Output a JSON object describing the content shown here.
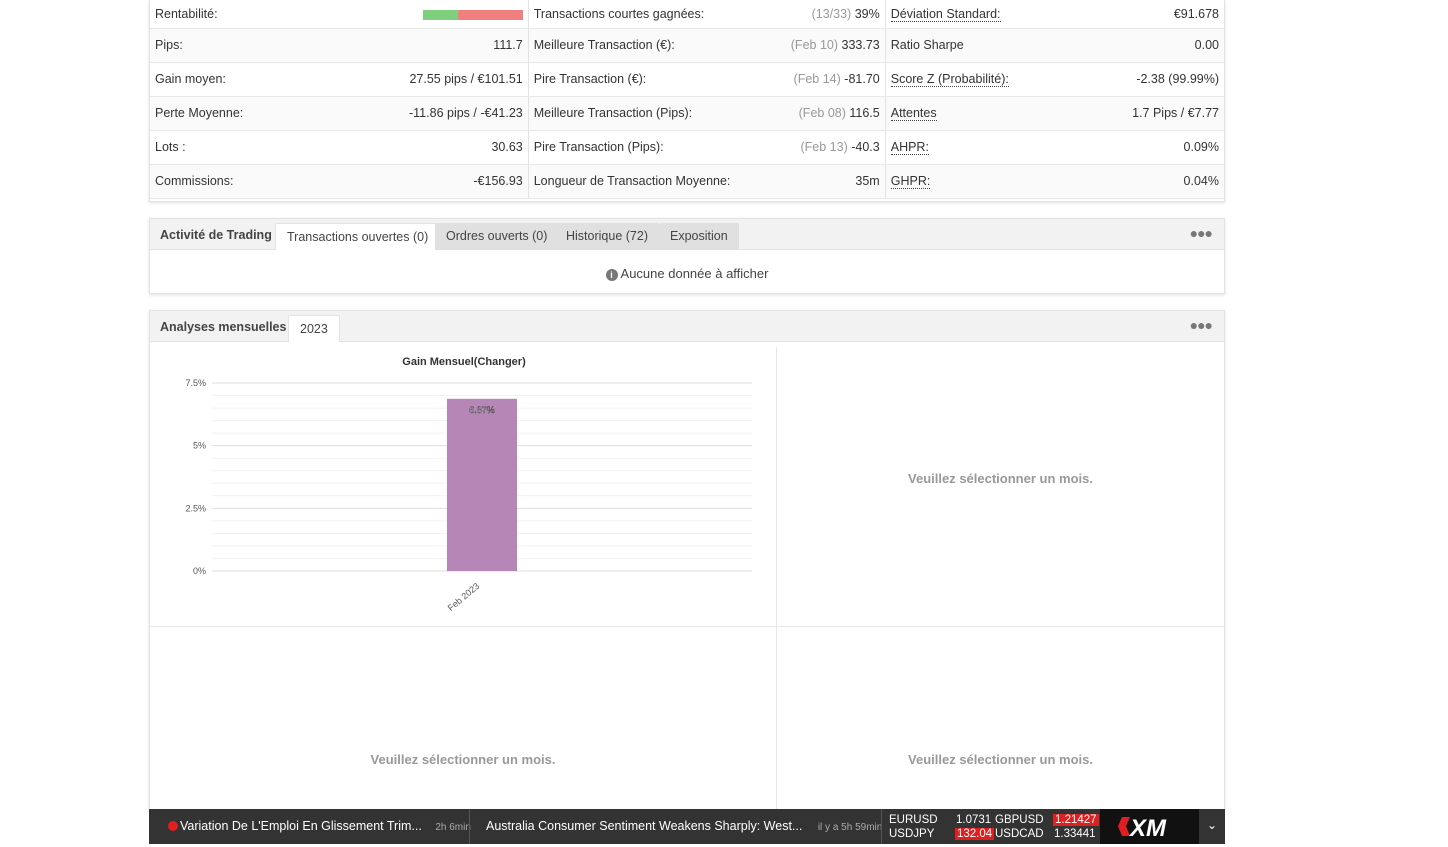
{
  "stats": {
    "rows": [
      {
        "l1": "Rentabilité:",
        "v1": "",
        "l2": "Transactions courtes gagnées:",
        "m2": "(13/33)",
        "v2": "39%",
        "l3": "Déviation Standard:",
        "v3": "€91.678"
      },
      {
        "l1": "Pips:",
        "v1": "111.7",
        "l2": "Meilleure Transaction (€):",
        "m2": "(Feb 10)",
        "v2": "333.73",
        "l3": "Ratio Sharpe",
        "v3": "0.00"
      },
      {
        "l1": "Gain moyen:",
        "v1": "27.55 pips / €101.51",
        "l2": "Pire Transaction (€):",
        "m2": "(Feb 14)",
        "v2": "-81.70",
        "l3": "Score Z (Probabilité):",
        "v3": "-2.38 (99.99%)"
      },
      {
        "l1": "Perte Moyenne:",
        "v1": "-11.86 pips / -€41.23",
        "l2": "Meilleure Transaction (Pips):",
        "m2": "(Feb 08)",
        "v2": "116.5",
        "l3": "Attentes",
        "v3": "1.7 Pips / €7.77"
      },
      {
        "l1": "Lots :",
        "v1": "30.63",
        "l2": "Pire Transaction (Pips):",
        "m2": "(Feb 13)",
        "v2": "-40.3",
        "l3": "AHPR:",
        "v3": "0.09%"
      },
      {
        "l1": "Commissions:",
        "v1": "-€156.93",
        "l2": "Longueur de Transaction Moyenne:",
        "m2": "",
        "v2": "35m",
        "l3": "GHPR:",
        "v3": "0.04%"
      }
    ],
    "profitability_win_fraction": 0.35,
    "colors": {
      "win": "#7ed07e",
      "loss": "#f08080"
    }
  },
  "trading": {
    "title": "Activité de Trading",
    "tabs": [
      "Transactions ouvertes (0)",
      "Ordres ouverts (0)",
      "Historique (72)",
      "Exposition"
    ],
    "no_data": "Aucune donnée à afficher"
  },
  "monthly": {
    "title": "Analyses mensuelles",
    "year_tab": "2023",
    "empty_msg": "Veuillez sélectionner un mois."
  },
  "chart_data": {
    "type": "bar",
    "title": "Gain Mensuel(Changer)",
    "categories": [
      "Feb 2023"
    ],
    "values": [
      6.87
    ],
    "data_labels": [
      "6.87%"
    ],
    "yticks": [
      "0%",
      "2.5%",
      "5%",
      "7.5%"
    ],
    "ylim": [
      0,
      7.5
    ],
    "bar_color": "#b586b6",
    "grid": true
  },
  "ticker": {
    "news1": "Variation De L'Emploi En Glissement Trim...",
    "time1": "2h 6min",
    "news2": "Australia Consumer Sentiment Weakens Sharply: West...",
    "time2": "il y a 5h 59min",
    "fx": {
      "eurusd_label": "EURUSD",
      "eurusd": "1.0731",
      "gbpusd_label": "GBPUSD",
      "gbpusd": "1.21427",
      "usdjpy_label": "USDJPY",
      "usdjpy": "132.04",
      "usdcad_label": "USDCAD",
      "usdcad": "1.33441"
    },
    "brand": "XM"
  }
}
